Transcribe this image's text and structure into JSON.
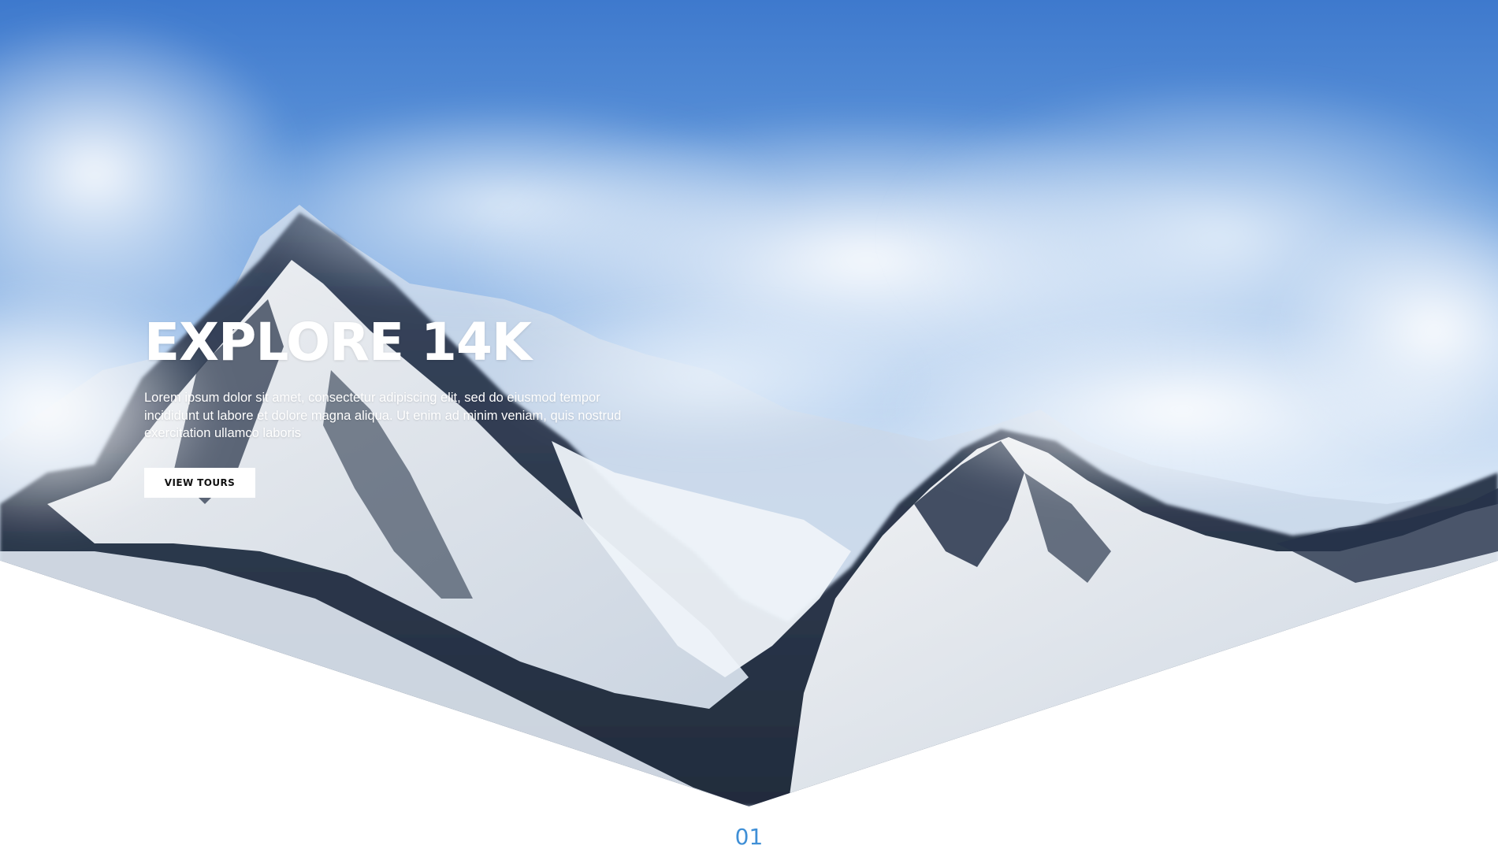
{
  "hero": {
    "title": "EXPLORE 14K",
    "description": "Lorem ipsum dolor sit amet, consectetur adipiscing elit, sed do eiusmod tempor incididunt ut labore et dolore magna aliqua. Ut enim ad minim veniam, quis nostrud exercitation ullamco laboris",
    "button_label": "VIEW TOURS",
    "background_image": "snowy-mountain-range-under-clouds"
  },
  "section": {
    "number": "01"
  },
  "colors": {
    "accent": "#3f8fd6",
    "sky": "#4a86d4",
    "snow": "#f3f6fb",
    "button_bg": "#ffffff"
  }
}
